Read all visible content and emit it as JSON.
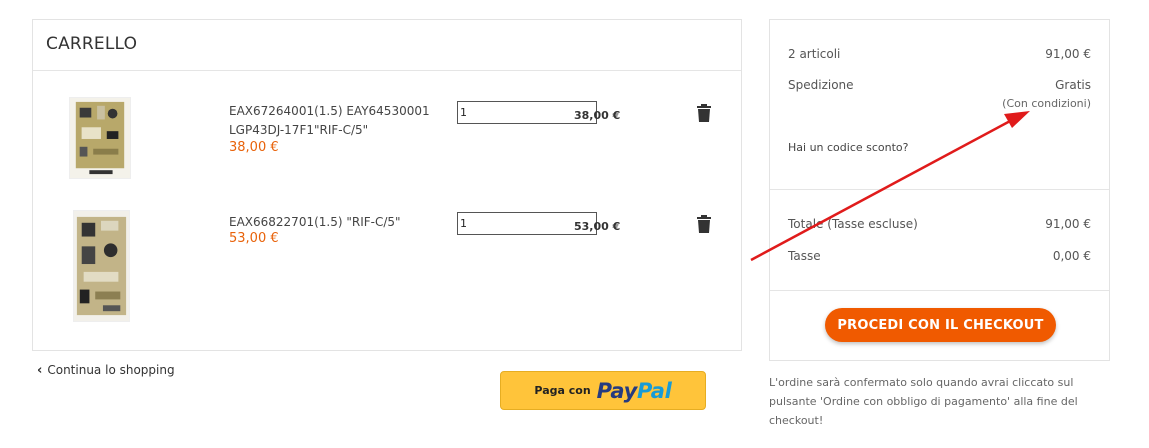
{
  "cart": {
    "title": "CARRELLO",
    "items": [
      {
        "name": "EAX67264001(1.5) EAY64530001 LGP43DJ-17F1\"RIF-C/5\"",
        "price": "38,00 €",
        "qty": "1",
        "line_total": "38,00 €",
        "image": "power-board-photo"
      },
      {
        "name": "EAX66822701(1.5) \"RIF-C/5\"",
        "price": "53,00 €",
        "qty": "1",
        "line_total": "53,00 €",
        "image": "power-board-photo"
      }
    ],
    "continue_label": "Continua lo shopping",
    "continue_icon": "chevron-left-icon"
  },
  "paypal": {
    "prefix": "Paga con",
    "brand_a": "Pay",
    "brand_b": "Pal"
  },
  "summary": {
    "items_label": "2 articoli",
    "items_value": "91,00 €",
    "shipping_label": "Spedizione",
    "shipping_value": "Gratis",
    "shipping_note": "(Con condizioni)",
    "promo_label": "Hai un codice sconto?",
    "total_label": "Totale (Tasse escluse)",
    "total_value": "91,00 €",
    "tax_label": "Tasse",
    "tax_value": "0,00 €",
    "checkout_label": "PROCEDI CON IL CHECKOUT"
  },
  "note": "L'ordine sarà confermato solo quando avrai cliccato sul pulsante 'Ordine con obbligo di pagamento' alla fine del checkout!",
  "colors": {
    "accent": "#f05a00",
    "price": "#e8620a",
    "paypal_bg": "#ffc43a",
    "annotation_arrow": "#e01b1b"
  }
}
